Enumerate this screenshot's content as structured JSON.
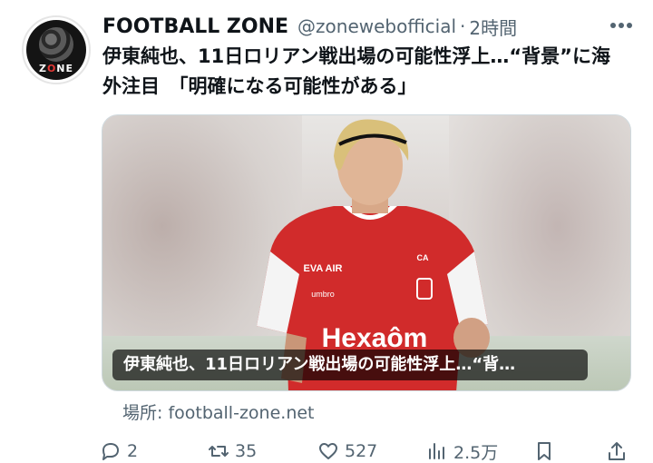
{
  "account": {
    "name": "FOOTBALL ZONE",
    "handle": "@zoneweboffical",
    "handle_display": "@zonewebofficial",
    "separator": "·",
    "time": "2時間",
    "avatar_text_left": "Z",
    "avatar_text_mid": "O",
    "avatar_text_right": "NE"
  },
  "tweet": {
    "text": "伊東純也、11日ロリアン戦出場の可能性浮上…“背景”に海外注目　「明確になる可能性がある」"
  },
  "card": {
    "caption": "伊東純也、11日ロリアン戦出場の可能性浮上…“背…",
    "source": "場所: football-zone.net",
    "image_alt": "Football player in red Stade de Reims jersey"
  },
  "actions": {
    "reply_count": "2",
    "retweet_count": "35",
    "like_count": "527",
    "views_count": "2.5万"
  },
  "colors": {
    "text": "#0f1419",
    "muted": "#536471",
    "jersey_red": "#d12b2b",
    "sleeve_white": "#f4f4f4"
  },
  "icons": [
    "more-icon",
    "reply-icon",
    "retweet-icon",
    "like-icon",
    "views-icon",
    "bookmark-icon",
    "share-icon"
  ]
}
